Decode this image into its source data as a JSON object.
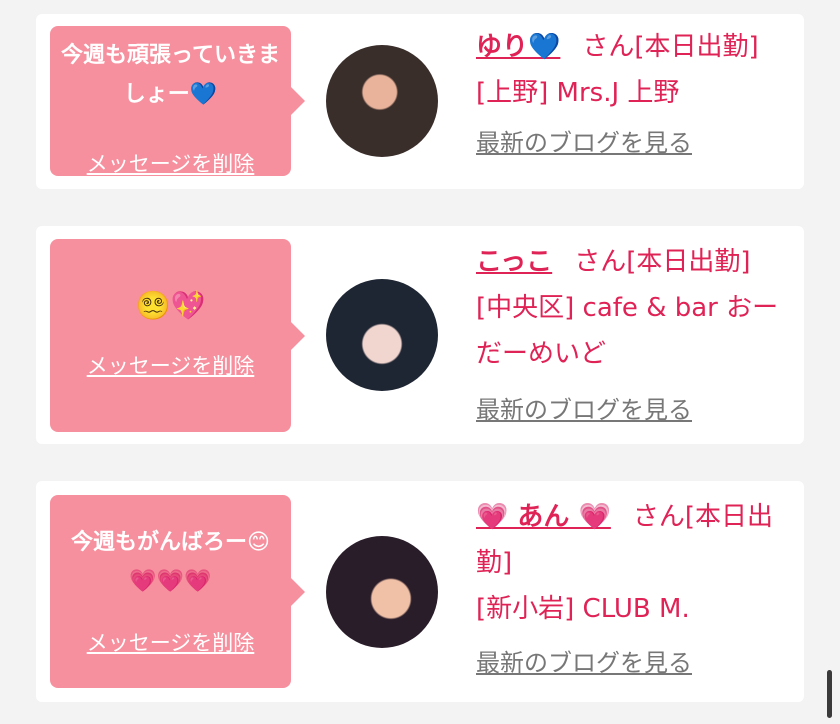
{
  "cards": [
    {
      "message": "今週も頑張っていきましょー💙",
      "delete_label": "メッセージを削除",
      "name": "ゆり💙",
      "status": "さん[本日出勤]",
      "shop": "[上野] Mrs.J 上野",
      "blog_label": "最新のブログを見る"
    },
    {
      "message": "😵‍💫💖",
      "delete_label": "メッセージを削除",
      "name": "こっこ",
      "status": "さん[本日出勤]",
      "shop": "[中央区] cafe & bar おーだーめいど",
      "blog_label": "最新のブログを見る"
    },
    {
      "message": "今週もがんばろー😊💗💗💗",
      "delete_label": "メッセージを削除",
      "name": "💗 あん 💗",
      "status": "さん[本日出勤]",
      "shop": "[新小岩] CLUB M.",
      "blog_label": "最新のブログを見る"
    }
  ],
  "colors": {
    "bubble": "#f7909e",
    "accent": "#e02356",
    "link_gray": "#777777",
    "page_background": "#f3f3f3"
  }
}
